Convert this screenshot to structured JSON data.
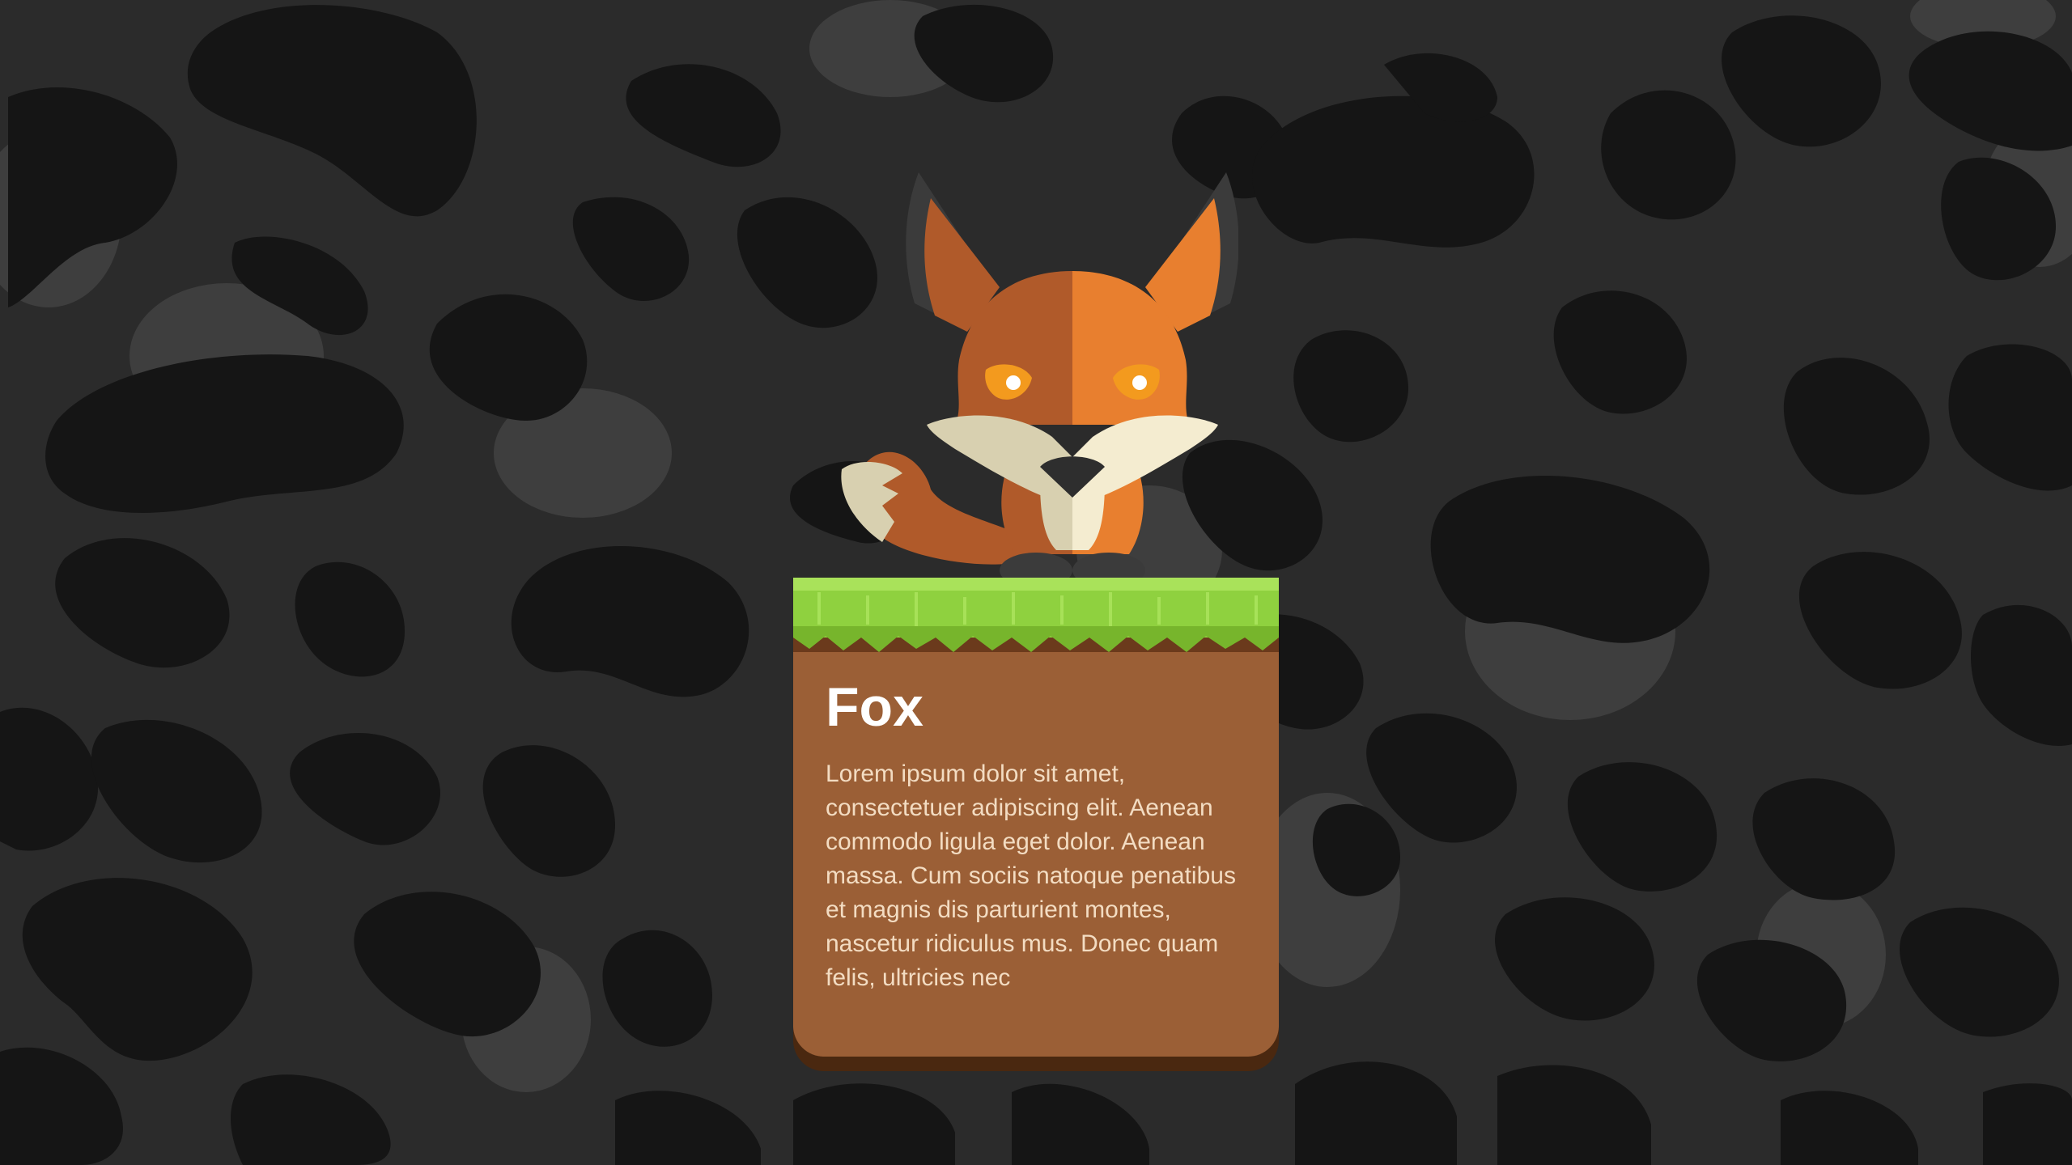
{
  "card": {
    "title": "Fox",
    "description": "Lorem ipsum dolor sit amet, consectetuer adipiscing elit. Aenean commodo ligula eget dolor. Aenean massa. Cum sociis natoque penatibus et magnis dis parturient montes, nascetur ridiculus mus. Donec quam felis, ultricies nec"
  },
  "illustration": {
    "character_icon": "fox-icon",
    "ground_icon": "grass-ground-icon",
    "background_icon": "leopard-spots-pattern"
  },
  "colors": {
    "background": "#2b2b2b",
    "spot_dark": "#151515",
    "spot_light": "#3e3e3e",
    "card": "#9b5f36",
    "card_edge": "#4a2810",
    "grass": "#8fd13f",
    "fox_dark": "#b05a2a",
    "fox_light": "#e87f2f",
    "fox_cream": "#f4ecd0"
  }
}
